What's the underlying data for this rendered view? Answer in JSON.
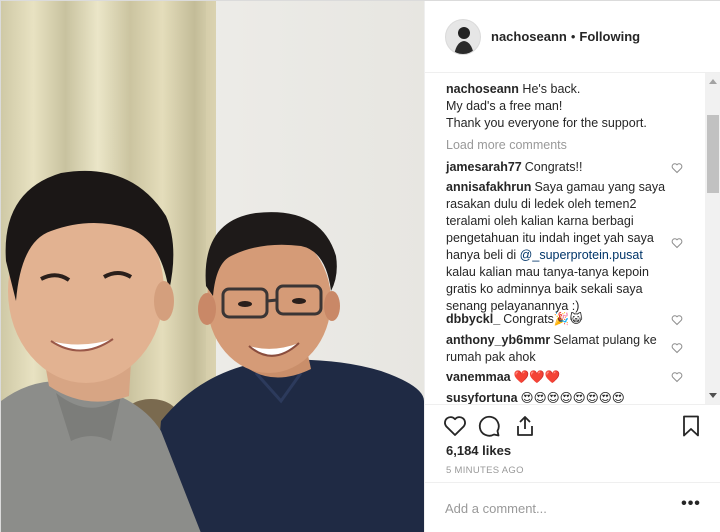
{
  "post": {
    "header": {
      "username": "nachoseann",
      "separator": "•",
      "follow_status": "Following"
    },
    "caption": {
      "username": "nachoseann",
      "lines": [
        "He's back.",
        "My dad's a free man!",
        "Thank you everyone for the support."
      ]
    },
    "load_more_label": "Load more comments",
    "comments": [
      {
        "user": "jamesarah77",
        "text": "Congrats!!"
      },
      {
        "user": "annisafakhrun",
        "text_before": "Saya gamau yang saya rasakan dulu di ledek oleh temen2 teralami oleh kalian karna berbagi pengetahuan itu indah inget yah saya hanya beli di ",
        "mention": "@_superprotein.pusat",
        "text_after": " kalau kalian mau tanya-tanya kepoin gratis ko adminnya baik sekali saya senang pelayanannya :)"
      },
      {
        "user": "dbbyckl_",
        "text": "Congrats🎉😺"
      },
      {
        "user": "anthony_yb6mmr",
        "text": "Selamat pulang ke rumah pak ahok"
      },
      {
        "user": "vanemmaa",
        "text": "❤️❤️❤️"
      },
      {
        "user": "susyfortuna",
        "text": "😍😍😍😍😍😍😍😍"
      }
    ],
    "likes": "6,184 likes",
    "timestamp": "5 MINUTES AGO",
    "add_comment_placeholder": "Add a comment...",
    "more_options": "•••",
    "icons": {
      "like": "heart-icon",
      "comment": "comment-bubble-icon",
      "share": "share-icon",
      "save": "bookmark-icon",
      "comment_like": "heart-small-icon"
    }
  }
}
